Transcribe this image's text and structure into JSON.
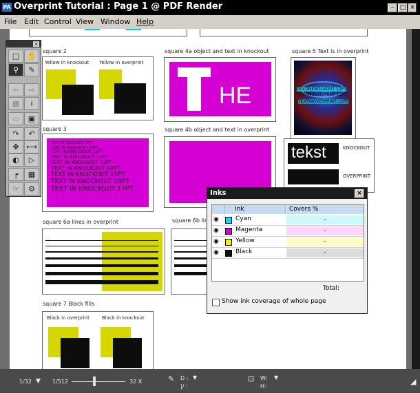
{
  "window": {
    "title": "Overprint Tutorial : Page 1 @ PDF Render",
    "icon_text": "PA",
    "controls": [
      "minimize-icon",
      "maximize-icon",
      "close-icon"
    ]
  },
  "menu": [
    "File",
    "Edit",
    "Control",
    "View",
    "Window",
    "Help"
  ],
  "page": {
    "labels": {
      "sq2": "square 2",
      "sq2_knock": "Yellow in knockout",
      "sq2_over": "Yellow in overprint",
      "sq4a": "square 4a object and text in knockout",
      "sq4a_text": "HE",
      "sq5": "square 5 Text is in overprint",
      "sq5_lines": [
        "TEXTINKNOCKOUT 12PT",
        "TEXTINOVERPRINT 12PT",
        "TEXTINOVERPRINT 12PT"
      ],
      "sq3": "square 3",
      "sq4b": "square 4b object and text in overprint",
      "tekst": "tekst",
      "knockout": "KNOCKOUT",
      "overprint": "OVERPRINT",
      "sq6a": "square 6a lines in overprint",
      "sq6b": "square 6b lin",
      "sq7": "square 7 Black fills",
      "sq7_over": "Black in overprint",
      "sq7_knock": "Black in knockout"
    },
    "knockout_text": [
      "TEXT IN KNOCKOUT 9PT",
      "TEXT IN KNOCKOUT 10PT",
      "TEXT IN KNOCKOUT 11PT",
      "TEXT IN KNOCKOUT 12PT",
      "TEXT IN KNOCKOUT 13PT",
      "TEXT IN KNOCKOUT 14PT",
      "TEXT IN KNOCKOUT 15PT",
      "TEXT IN KNOCKOUT 16PT",
      "TEXT IN KNOCKOUT 17PT"
    ]
  },
  "colors": {
    "cyan": "#00e0f0",
    "magenta": "#d400d4",
    "yellow": "#e8e800",
    "black": "#111111"
  },
  "inks_panel": {
    "title": "Inks",
    "col_ink": "Ink",
    "col_covers": "Covers %",
    "rows": [
      {
        "name": "Cyan",
        "swatch": "#00e0f0",
        "bar": "#ccf7fb",
        "value": "-"
      },
      {
        "name": "Magenta",
        "swatch": "#d400d4",
        "bar": "#fcd7fc",
        "value": "-"
      },
      {
        "name": "Yellow",
        "swatch": "#f0f000",
        "bar": "#fdfdc8",
        "value": "-"
      },
      {
        "name": "Black",
        "swatch": "#111111",
        "bar": "#dcdcdc",
        "value": "-"
      }
    ],
    "total_label": "Total:",
    "checkbox_label": "Show ink coverage of whole page",
    "checkbox_checked": false
  },
  "status": {
    "zoom_min": "1/32",
    "zoom_ratio": "1/512",
    "zoom_max": "32 X",
    "d_label": "D :",
    "h_dim_label": "|/ :",
    "w_label": "W:",
    "h_label": "H:"
  }
}
